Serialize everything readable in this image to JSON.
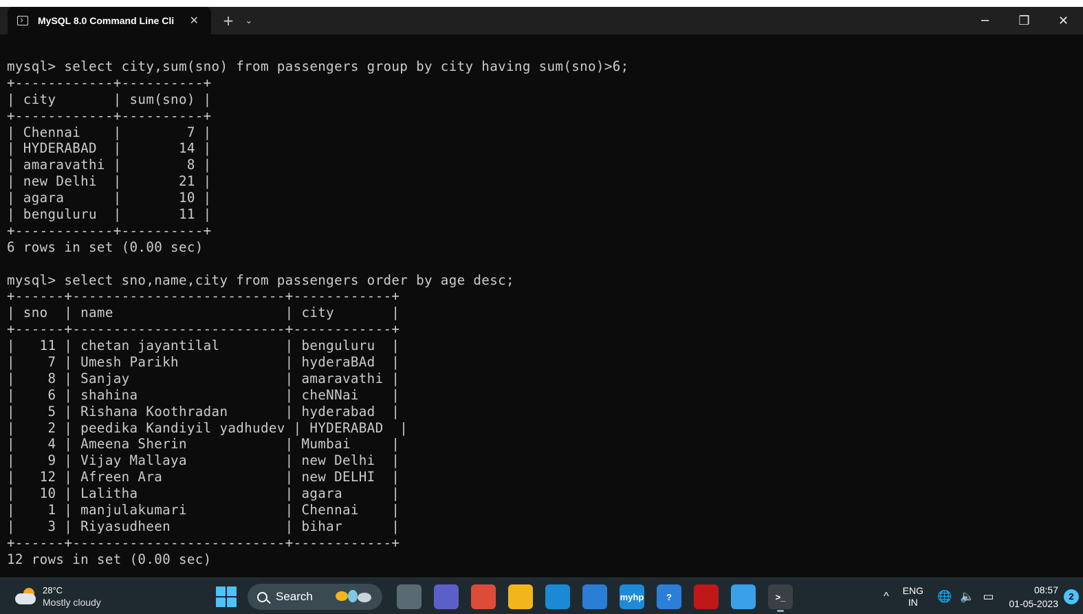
{
  "window": {
    "tab_title": "MySQL 8.0 Command Line Cli",
    "tab_close": "✕",
    "new_tab": "+",
    "tab_menu": "⌄",
    "minimize": "─",
    "restore": "❐",
    "close": "✕"
  },
  "terminal": {
    "lines": [
      "mysql> select city,sum(sno) from passengers group by city having sum(sno)>6;",
      "+------------+----------+",
      "| city       | sum(sno) |",
      "+------------+----------+",
      "| Chennai    |        7 |",
      "| HYDERABAD  |       14 |",
      "| amaravathi |        8 |",
      "| new Delhi  |       21 |",
      "| agara      |       10 |",
      "| benguluru  |       11 |",
      "+------------+----------+",
      "6 rows in set (0.00 sec)",
      "",
      "mysql> select sno,name,city from passengers order by age desc;",
      "+------+--------------------------+------------+",
      "| sno  | name                     | city       |",
      "+------+--------------------------+------------+",
      "|   11 | chetan jayantilal        | benguluru  |",
      "|    7 | Umesh Parikh             | hyderaBAd  |",
      "|    8 | Sanjay                   | amaravathi |",
      "|    6 | shahina                  | cheNNai    |",
      "|    5 | Rishana Koothradan       | hyderabad  |",
      "|    2 | peedika Kandiyil yadhudev | HYDERABAD  |",
      "|    4 | Ameena Sherin            | Mumbai     |",
      "|    9 | Vijay Mallaya            | new Delhi  |",
      "|   12 | Afreen Ara               | new DELHI  |",
      "|   10 | Lalitha                  | agara      |",
      "|    1 | manjulakumari            | Chennai    |",
      "|    3 | Riyasudheen              | bihar      |",
      "+------+--------------------------+------------+",
      "12 rows in set (0.00 sec)"
    ]
  },
  "taskbar": {
    "weather_temp": "28°C",
    "weather_desc": "Mostly cloudy",
    "search_label": "Search",
    "apps": [
      {
        "name": "task-view-icon",
        "color": "#5a6a72",
        "glyph": ""
      },
      {
        "name": "teams-chat-icon",
        "color": "#5b5fc7",
        "glyph": ""
      },
      {
        "name": "chrome-icon",
        "color": "#dd4b39",
        "glyph": ""
      },
      {
        "name": "file-explorer-icon",
        "color": "#f2b51c",
        "glyph": ""
      },
      {
        "name": "edge-icon",
        "color": "#1a8ad4",
        "glyph": ""
      },
      {
        "name": "microsoft-store-icon",
        "color": "#2a7ed6",
        "glyph": ""
      },
      {
        "name": "myhp-icon",
        "color": "#1f8bd8",
        "glyph": "myhp"
      },
      {
        "name": "get-help-icon",
        "color": "#2c7fd8",
        "glyph": "?"
      },
      {
        "name": "mcafee-icon",
        "color": "#c01818",
        "glyph": ""
      },
      {
        "name": "photos-icon",
        "color": "#3aa0e8",
        "glyph": ""
      },
      {
        "name": "terminal-icon",
        "color": "#3a4046",
        "glyph": ">_"
      }
    ],
    "tray_chevron": "^",
    "lang_top": "ENG",
    "lang_bottom": "IN",
    "time": "08:57",
    "date": "01-05-2023",
    "notifications": "2"
  }
}
